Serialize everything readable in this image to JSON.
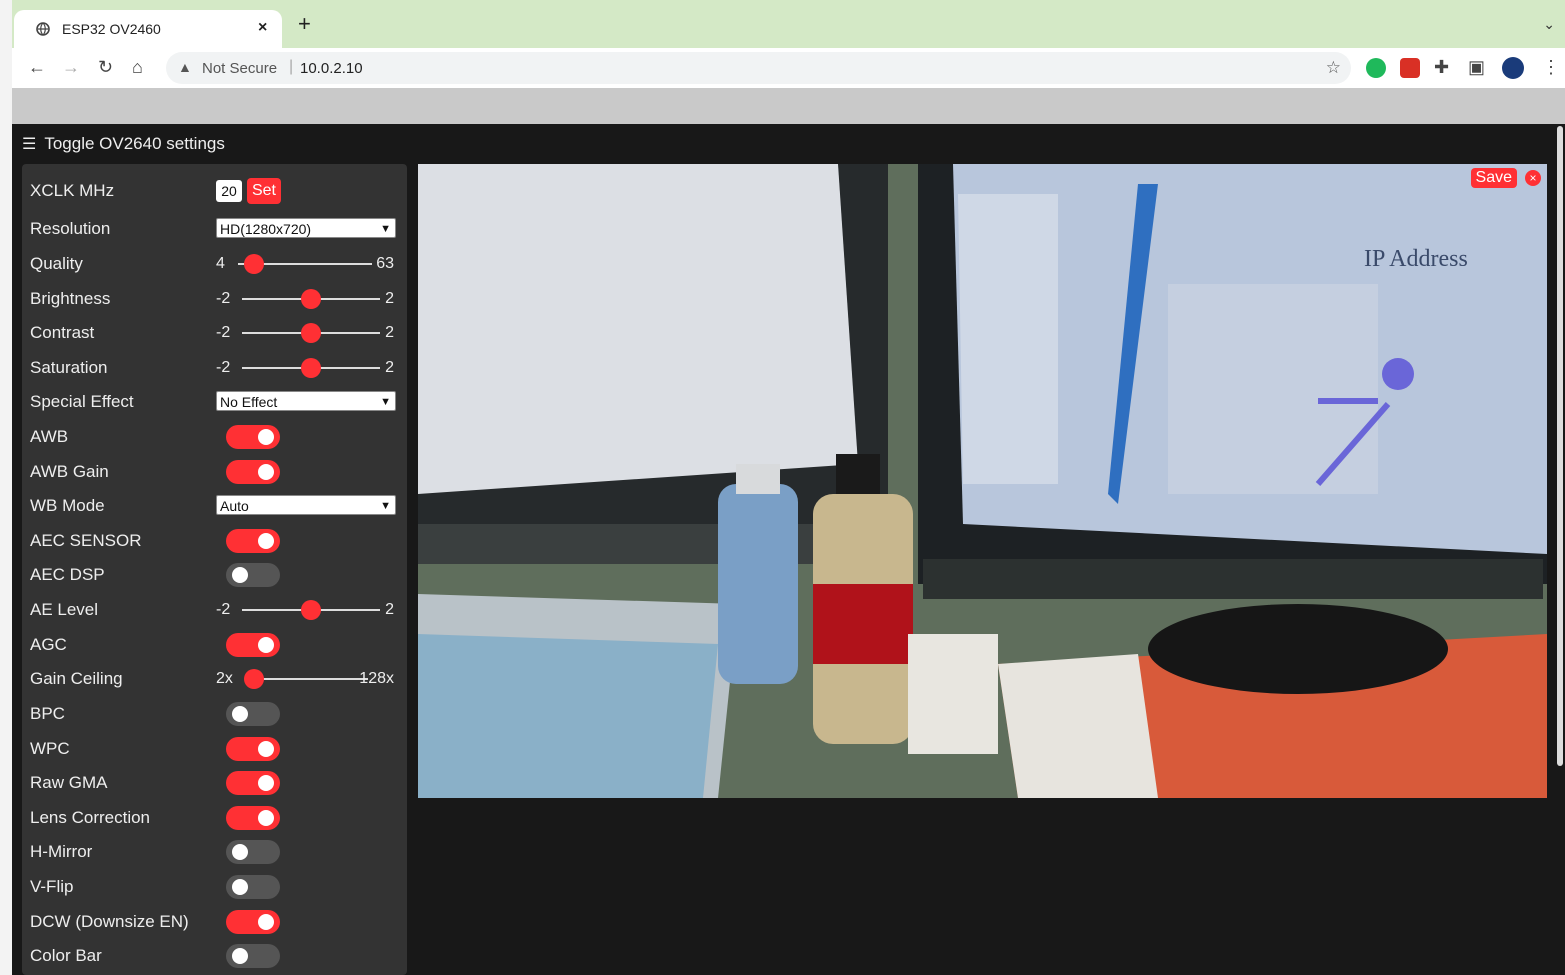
{
  "browser": {
    "tab_title": "ESP32 OV2460",
    "tab_close": "×",
    "new_tab": "+",
    "tab_menu": "⌄",
    "security_label": "Not Secure",
    "url": "10.0.2.10",
    "separator": "|",
    "icons": [
      "back-icon",
      "forward-icon",
      "reload-icon",
      "home-icon",
      "star-icon",
      "extension-icons",
      "profile-avatar",
      "more-icon"
    ]
  },
  "app": {
    "menu_toggle": "Toggle OV2640 settings",
    "colors": {
      "accent": "#ff3034",
      "panel": "#333333",
      "background": "#181818"
    },
    "xclk": {
      "label": "XCLK MHz",
      "value": "20",
      "button": "Set"
    },
    "resolution": {
      "label": "Resolution",
      "value": "HD(1280x720)"
    },
    "quality": {
      "label": "Quality",
      "min": "4",
      "max": "63",
      "fraction": 0.12
    },
    "brightness": {
      "label": "Brightness",
      "min": "-2",
      "max": "2",
      "fraction": 0.5
    },
    "contrast": {
      "label": "Contrast",
      "min": "-2",
      "max": "2",
      "fraction": 0.5
    },
    "saturation": {
      "label": "Saturation",
      "min": "-2",
      "max": "2",
      "fraction": 0.5
    },
    "special_effect": {
      "label": "Special Effect",
      "value": "No Effect"
    },
    "awb": {
      "label": "AWB",
      "on": true
    },
    "awb_gain": {
      "label": "AWB Gain",
      "on": true
    },
    "wb_mode": {
      "label": "WB Mode",
      "value": "Auto"
    },
    "aec_sensor": {
      "label": "AEC SENSOR",
      "on": true
    },
    "aec_dsp": {
      "label": "AEC DSP",
      "on": false
    },
    "ae_level": {
      "label": "AE Level",
      "min": "-2",
      "max": "2",
      "fraction": 0.5
    },
    "agc": {
      "label": "AGC",
      "on": true
    },
    "gain_ceiling": {
      "label": "Gain Ceiling",
      "min": "2x",
      "max": "128x",
      "fraction": 0.0
    },
    "bpc": {
      "label": "BPC",
      "on": false
    },
    "wpc": {
      "label": "WPC",
      "on": true
    },
    "raw_gma": {
      "label": "Raw GMA",
      "on": true
    },
    "lens_correction": {
      "label": "Lens Correction",
      "on": true
    },
    "h_mirror": {
      "label": "H-Mirror",
      "on": false
    },
    "v_flip": {
      "label": "V-Flip",
      "on": false
    },
    "dcw": {
      "label": "DCW (Downsize EN)",
      "on": true
    },
    "color_bar": {
      "label": "Color Bar",
      "on": false
    },
    "stream": {
      "save_label": "Save",
      "close_label": "×",
      "slide_text": "IP Address"
    }
  }
}
